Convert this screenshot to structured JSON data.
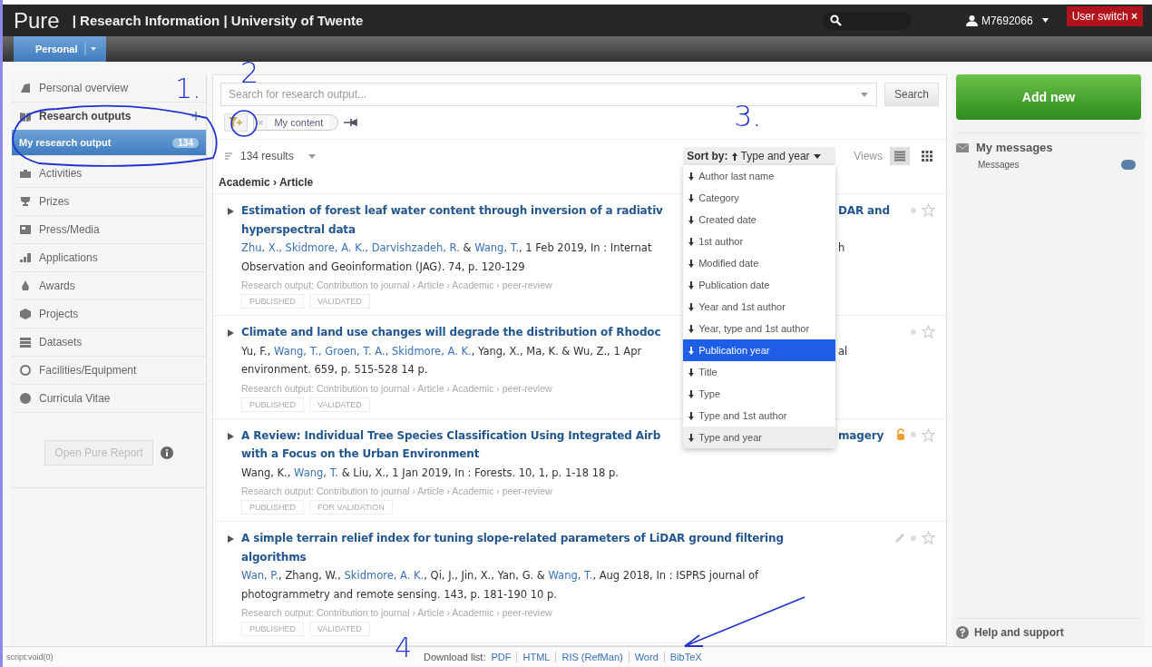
{
  "header": {
    "logo": "Pure",
    "title": "| Research Information | University of Twente",
    "user": "M7692066",
    "user_switch": "User switch",
    "user_switch_close": "×"
  },
  "nav": {
    "tabs": [
      {
        "label": "Personal",
        "selected": true
      }
    ]
  },
  "sidebar": {
    "items": [
      {
        "label": "Personal overview",
        "kind": "item",
        "selected": false
      },
      {
        "label": "Research outputs",
        "kind": "heading",
        "selected": false,
        "children": [
          {
            "label": "My research output",
            "count": "134",
            "selected": true
          }
        ]
      },
      {
        "label": "Activities",
        "kind": "item",
        "selected": false
      },
      {
        "label": "Prizes",
        "kind": "item",
        "selected": false
      },
      {
        "label": "Press/Media",
        "kind": "item",
        "selected": false
      },
      {
        "label": "Applications",
        "kind": "item",
        "selected": false
      },
      {
        "label": "Awards",
        "kind": "item",
        "selected": false
      },
      {
        "label": "Projects",
        "kind": "item",
        "selected": false
      },
      {
        "label": "Datasets",
        "kind": "item",
        "selected": false
      },
      {
        "label": "Facilities/Equipment",
        "kind": "item",
        "selected": false
      },
      {
        "label": "Curricula Vitae",
        "kind": "item",
        "selected": false
      }
    ],
    "report_button": {
      "label": "Open Pure Report",
      "disabled": true
    }
  },
  "main": {
    "search": {
      "placeholder": "Search for research output..."
    },
    "search_button": "Search",
    "filter_chip": {
      "label": "My content",
      "remove": "×"
    },
    "results_count": "134 results",
    "sort_label": "Sort by:",
    "sort_value": "Type and year",
    "views_label": "Views",
    "views": [
      {
        "selected": true
      },
      {
        "selected": false
      }
    ],
    "breadcrumb": "Academic › Article",
    "sort_menu": [
      {
        "label": "Author last name",
        "selected": false,
        "highlighted": false
      },
      {
        "label": "Category",
        "selected": false,
        "highlighted": false
      },
      {
        "label": "Created date",
        "selected": false,
        "highlighted": false
      },
      {
        "label": "1st author",
        "selected": false,
        "highlighted": false
      },
      {
        "label": "Modified date",
        "selected": false,
        "highlighted": false
      },
      {
        "label": "Publication date",
        "selected": false,
        "highlighted": false
      },
      {
        "label": "Year and 1st author",
        "selected": false,
        "highlighted": false
      },
      {
        "label": "Year, type and 1st author",
        "selected": false,
        "highlighted": false
      },
      {
        "label": "Publication year",
        "selected": false,
        "highlighted": true
      },
      {
        "label": "Title",
        "selected": false,
        "highlighted": false
      },
      {
        "label": "Type",
        "selected": false,
        "highlighted": false
      },
      {
        "label": "Type and 1st author",
        "selected": false,
        "highlighted": false
      },
      {
        "label": "Type and year",
        "selected": true,
        "highlighted": false
      }
    ],
    "results": [
      {
        "title_lines": [
          {
            "text": "Estimation of forest leaf water content through inversion of a radiativ",
            "right": "DAR and"
          },
          {
            "text": "hyperspectral data"
          }
        ],
        "citation_lines": [
          {
            "segments": [
              {
                "text": "Zhu, X., Skidmore, A. K., Darvishzadeh, R.",
                "linked": true
              },
              {
                "text": " & ",
                "linked": false
              },
              {
                "text": "Wang, T.",
                "linked": true
              },
              {
                "text": ", 1 Feb 2019, In : Internat",
                "linked": false
              }
            ],
            "right": "h"
          },
          {
            "segments": [
              {
                "text": "Observation and Geoinformation (JAG). 74, p. 120-129",
                "linked": false
              }
            ]
          }
        ],
        "meta": "Research output: Contribution to journal › Article › Academic › peer-review",
        "tags": [
          "PUBLISHED",
          "VALIDATED"
        ],
        "open_access": false,
        "editable": false
      },
      {
        "title_lines": [
          {
            "text": "Climate and land use changes will degrade the distribution of Rhodoc"
          }
        ],
        "citation_lines": [
          {
            "segments": [
              {
                "text": "Yu, F., ",
                "linked": false
              },
              {
                "text": "Wang, T., Groen, T. A., Skidmore, A. K.",
                "linked": true
              },
              {
                "text": ", Yang, X., Ma, K. & Wu, Z., 1 Apr",
                "linked": false
              }
            ],
            "right": "al"
          },
          {
            "segments": [
              {
                "text": "environment. 659, p. 515-528 14 p.",
                "linked": false
              }
            ]
          }
        ],
        "meta": "Research output: Contribution to journal › Article › Academic › peer-review",
        "tags": [
          "PUBLISHED",
          "VALIDATED"
        ],
        "open_access": false,
        "editable": false
      },
      {
        "title_lines": [
          {
            "text": "A Review: Individual Tree Species Classification Using Integrated Airb",
            "right": "magery"
          },
          {
            "text": "with a Focus on the Urban Environment"
          }
        ],
        "citation_lines": [
          {
            "segments": [
              {
                "text": "Wang, K., ",
                "linked": false
              },
              {
                "text": "Wang, T.",
                "linked": true
              },
              {
                "text": " & Liu, X., 1 Jan 2019, In : Forests. 10, 1, p. 1-18 18 p.",
                "linked": false
              }
            ]
          }
        ],
        "meta": "Research output: Contribution to journal › Article › Academic › peer-review",
        "tags": [
          "PUBLISHED",
          "FOR VALIDATION"
        ],
        "open_access": true,
        "editable": false
      },
      {
        "title_lines": [
          {
            "text": "A simple terrain relief index for tuning slope-related parameters of LiDAR ground filtering"
          },
          {
            "text": "algorithms"
          }
        ],
        "citation_lines": [
          {
            "segments": [
              {
                "text": "Wan, P.",
                "linked": true
              },
              {
                "text": ", Zhang, W., ",
                "linked": false
              },
              {
                "text": "Skidmore, A. K.",
                "linked": true
              },
              {
                "text": ", Qi, J., Jin, X., Yan, G. & ",
                "linked": false
              },
              {
                "text": "Wang, T.",
                "linked": true
              },
              {
                "text": ", Aug 2018, In : ISPRS journal of",
                "linked": false
              }
            ]
          },
          {
            "segments": [
              {
                "text": "photogrammetry and remote sensing. 143, p. 181-190 10 p.",
                "linked": false
              }
            ]
          }
        ],
        "meta": "Research output: Contribution to journal › Article › Academic › peer-review",
        "tags": [
          "PUBLISHED",
          "VALIDATED"
        ],
        "open_access": false,
        "editable": true
      }
    ]
  },
  "right": {
    "add_new": "Add new",
    "messages_heading": "My messages",
    "messages_label": "Messages",
    "help": "Help and support"
  },
  "footer": {
    "status": "script:void(0)",
    "download_label": "Download list:",
    "formats": [
      "PDF",
      "HTML",
      "RIS (RefMan)",
      "Word",
      "BibTeX"
    ]
  },
  "annotations": [
    {
      "text": "1."
    },
    {
      "text": "2"
    },
    {
      "text": "3."
    },
    {
      "text": "4"
    }
  ]
}
